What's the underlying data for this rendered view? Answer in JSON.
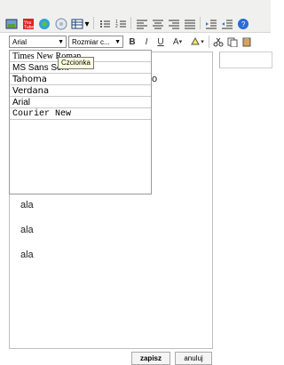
{
  "toolbar": {
    "font_select": "Arial",
    "size_select": "Rozmiar c...",
    "bold_label": "B",
    "italic_label": "I",
    "underline_label": "U",
    "font_color_label": "A",
    "icons": [
      "picture-icon",
      "youtube-icon",
      "skype-icon",
      "map-icon",
      "table-icon",
      "bullet-list-icon",
      "numbered-list-icon",
      "align-left-icon",
      "align-center-icon",
      "align-right-icon",
      "align-justify-icon",
      "indent-icon",
      "outdent-icon",
      "help-icon",
      "cut-icon",
      "copy-icon",
      "paste-icon",
      "highlight-icon"
    ]
  },
  "font_menu": {
    "items": [
      "Times New Roman",
      "MS Sans Serif",
      "Tahoma",
      "Verdana",
      "Arial",
      "Courier New"
    ],
    "tooltip": "Czcionka"
  },
  "editor": {
    "hidden_text": "o",
    "lines": [
      "ala",
      "ala",
      "ala"
    ]
  },
  "buttons": {
    "save": "zapisz",
    "cancel": "anuluj"
  }
}
